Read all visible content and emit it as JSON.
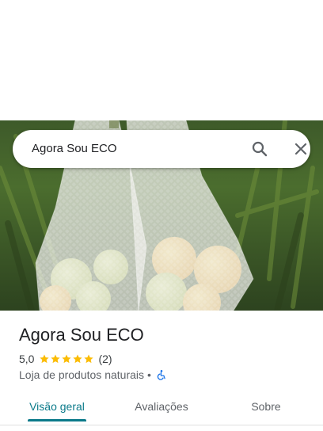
{
  "search": {
    "query": "Agora Sou ECO"
  },
  "place": {
    "name": "Agora Sou ECO",
    "rating": "5,0",
    "stars": 5,
    "review_count": "(2)",
    "category": "Loja de produtos naturais",
    "separator": "•"
  },
  "tabs": [
    {
      "label": "Visão geral",
      "active": true
    },
    {
      "label": "Avaliações",
      "active": false
    },
    {
      "label": "Sobre",
      "active": false
    }
  ],
  "colors": {
    "accent": "#0b7a8a",
    "star": "#fbbc04",
    "accessibility": "#1a73e8"
  },
  "icons": [
    "search-icon",
    "close-icon",
    "star-icon",
    "wheelchair-icon"
  ]
}
